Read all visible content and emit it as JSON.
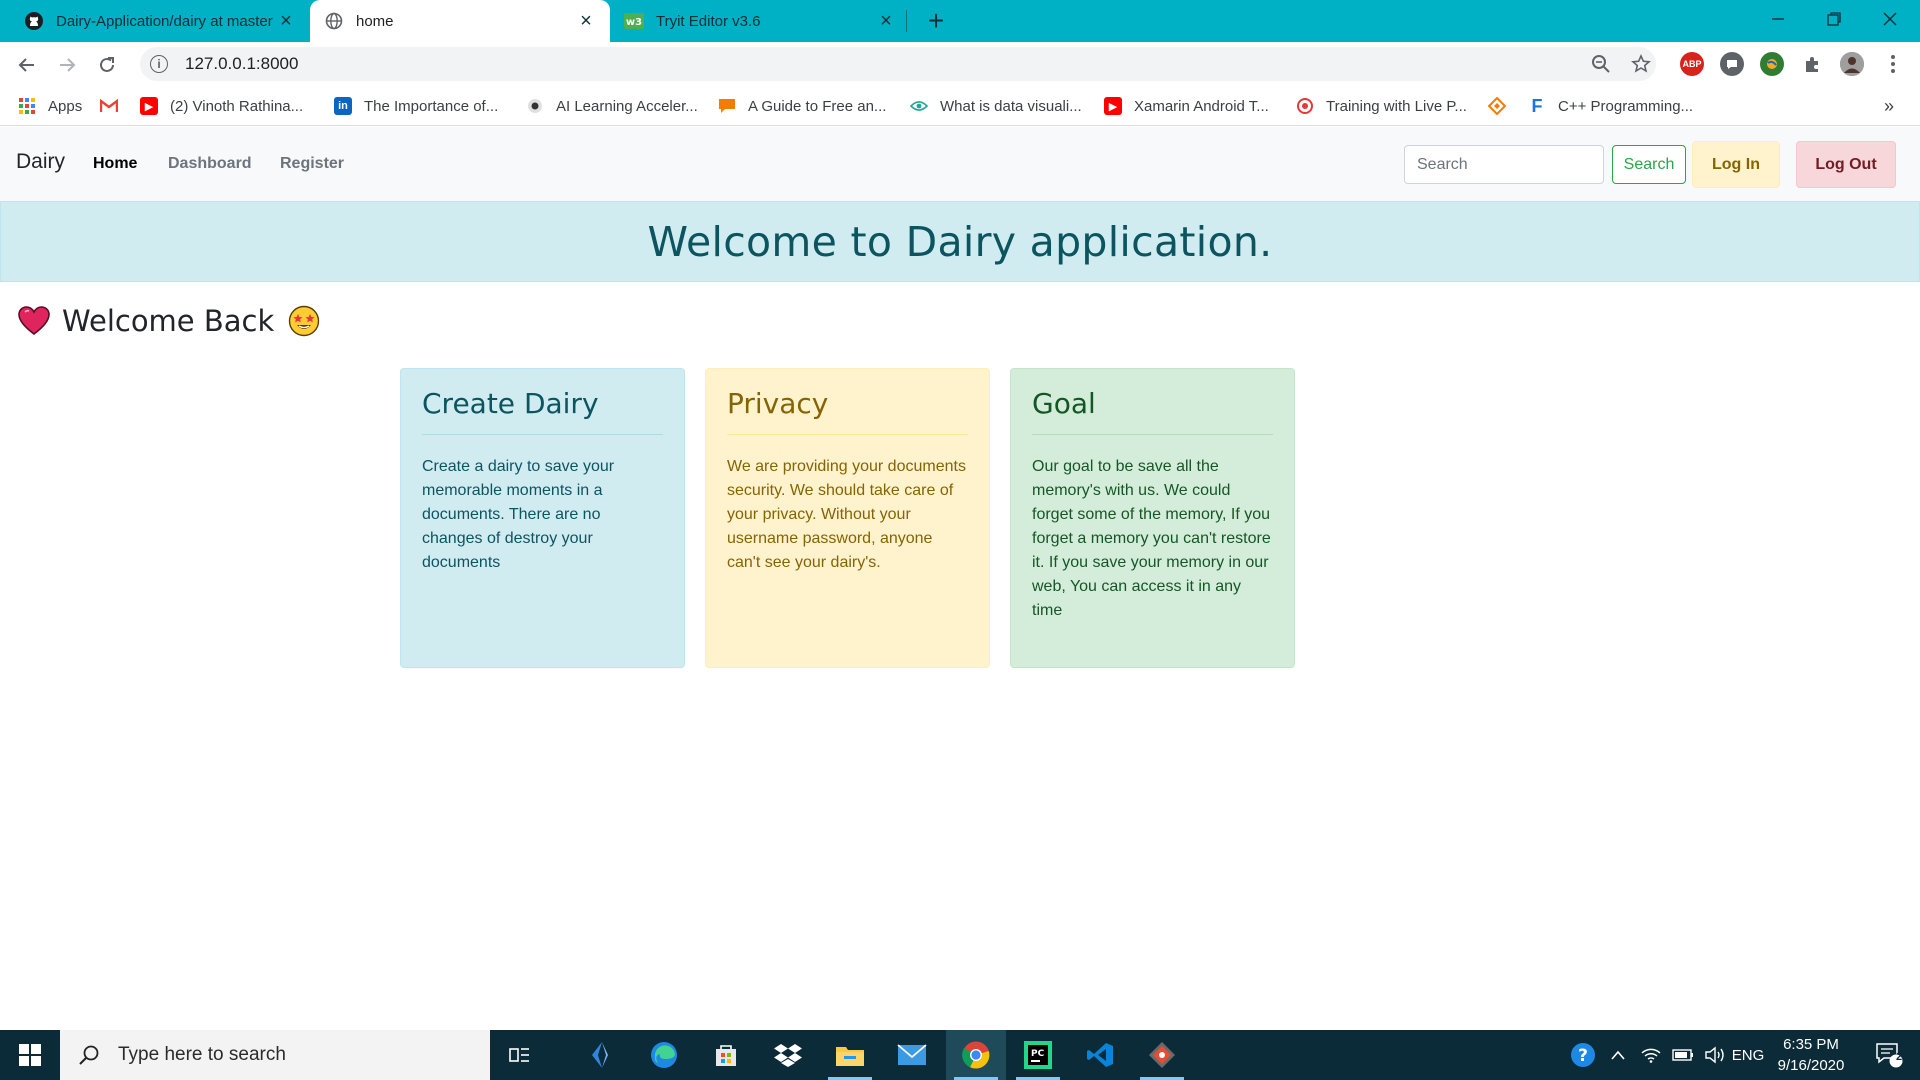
{
  "browser": {
    "tabs": [
      {
        "title": "Dairy-Application/dairy at master",
        "icon": "github-icon"
      },
      {
        "title": "home",
        "icon": "globe-icon"
      },
      {
        "title": "Tryit Editor v3.6",
        "icon": "w3schools-icon"
      }
    ],
    "url": "127.0.0.1:8000",
    "bookmarks": [
      {
        "label": "Apps"
      },
      {
        "label": ""
      },
      {
        "label": "(2) Vinoth Rathina..."
      },
      {
        "label": "The Importance of..."
      },
      {
        "label": "AI Learning Acceler..."
      },
      {
        "label": "A Guide to Free an..."
      },
      {
        "label": "What is data visuali..."
      },
      {
        "label": "Xamarin Android T..."
      },
      {
        "label": "Training with Live P..."
      },
      {
        "label": ""
      },
      {
        "label": "C++ Programming..."
      }
    ],
    "bookmarks_overflow": "»",
    "extension_abp": "ABP"
  },
  "navbar": {
    "brand": "Dairy",
    "links": [
      "Home",
      "Dashboard",
      "Register"
    ],
    "search_placeholder": "Search",
    "search_button": "Search",
    "login_button": "Log In",
    "logout_button": "Log Out"
  },
  "banner": {
    "title": "Welcome to Dairy application."
  },
  "welcome": {
    "text": "Welcome Back"
  },
  "cards": [
    {
      "title": "Create Dairy",
      "body": "Create a dairy to save your memorable moments in a documents. There are no changes of destroy your documents"
    },
    {
      "title": "Privacy",
      "body": "We are providing your documents security. We should take care of your privacy. Without your username password, anyone can't see your dairy's."
    },
    {
      "title": "Goal",
      "body": "Our goal to be save all the memory's with us. We could forget some of the memory, If you forget a memory you can't restore it. If you save your memory in our web, You can access it in any time"
    }
  ],
  "taskbar": {
    "search_placeholder": "Type here to search",
    "language": "ENG",
    "time": "6:35 PM",
    "date": "9/16/2020",
    "notification_count": "2"
  }
}
